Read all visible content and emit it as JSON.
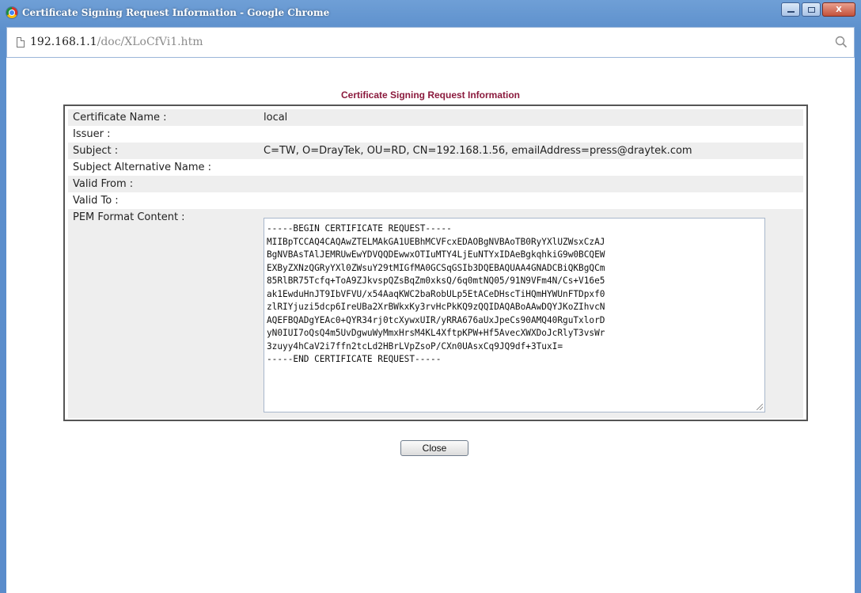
{
  "window": {
    "title": "Certificate Signing Request Information - Google Chrome",
    "minimize_label": "",
    "maximize_label": "",
    "close_label": "X"
  },
  "address": {
    "host": "192.168.1.1",
    "path": "/doc/XLoCfVi1.htm"
  },
  "dialog": {
    "title": "Certificate Signing Request Information",
    "fields": [
      {
        "label": "Certificate Name :",
        "value": "local"
      },
      {
        "label": "Issuer :",
        "value": ""
      },
      {
        "label": "Subject :",
        "value": "C=TW, O=DrayTek, OU=RD, CN=192.168.1.56, emailAddress=press@draytek.com"
      },
      {
        "label": "Subject Alternative Name :",
        "value": ""
      },
      {
        "label": "Valid From :",
        "value": ""
      },
      {
        "label": "Valid To :",
        "value": ""
      }
    ],
    "pem_label": "PEM Format Content :",
    "pem_content": "-----BEGIN CERTIFICATE REQUEST-----\nMIIBpTCCAQ4CAQAwZTELMAkGA1UEBhMCVFcxEDAOBgNVBAoTB0RyYXlUZWsxCzAJ\nBgNVBAsTAlJEMRUwEwYDVQQDEwwxOTIuMTY4LjEuNTYxIDAeBgkqhkiG9w0BCQEW\nEXByZXNzQGRyYXl0ZWsuY29tMIGfMA0GCSqGSIb3DQEBAQUAA4GNADCBiQKBgQCm\n85RlBR75Tcfq+ToA9ZJkvspQZsBqZm0xksQ/6q0mtNQ05/91N9VFm4N/Cs+V16e5\nak1EwduHnJT9IbVFVU/x54AaqKWC2baRobULp5EtACeDHscTiHQmHYWUnFTDpxf0\nzlRIYjuzi5dcp6IreUBa2XrBWkxKy3rvHcPkKQ9zQQIDAQABoAAwDQYJKoZIhvcN\nAQEFBQADgYEAc0+QYR34rj0tcXywxUIR/yRRA676aUxJpeCs90AMQ40RguTxlorD\nyN0IUI7oQsQ4m5UvDgwuWyMmxHrsM4KL4XftpKPW+Hf5AvecXWXDoJcRlyT3vsWr\n3zuyy4hCaV2i7ffn2tcLd2HBrLVpZsoP/CXn0UAsxCq9JQ9df+3TuxI=\n-----END CERTIFICATE REQUEST-----",
    "close_button": "Close"
  }
}
